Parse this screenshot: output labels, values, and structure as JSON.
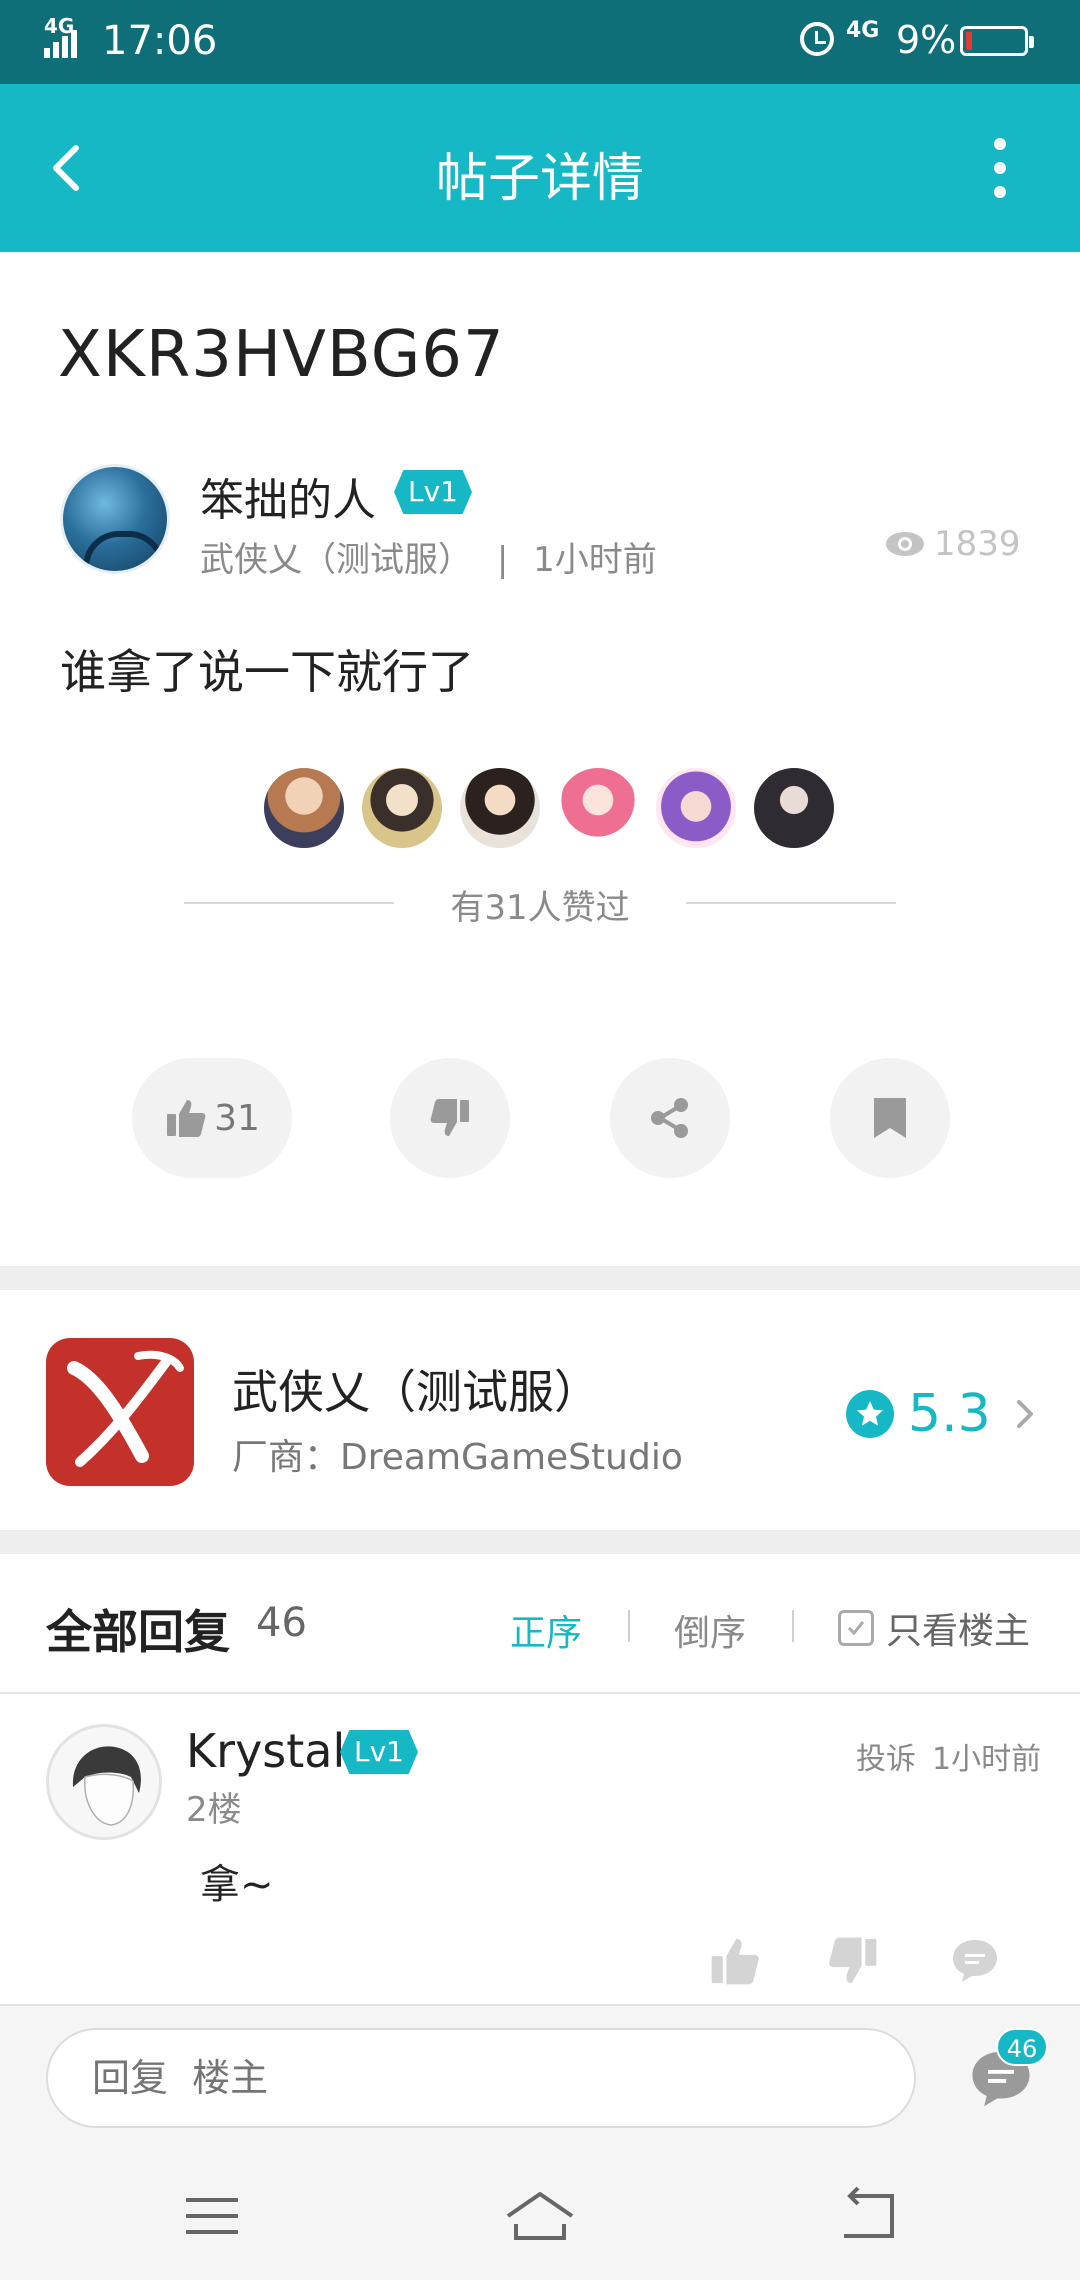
{
  "status_bar": {
    "network": "4G",
    "time": "17:06",
    "network2": "4G",
    "battery": "9%"
  },
  "header": {
    "title": "帖子详情"
  },
  "post": {
    "title": "XKR3HVBG67",
    "author": "笨拙的人",
    "level": "Lv1",
    "game": "武侠乂（测试服）",
    "separator": "|",
    "time": "1小时前",
    "views": "1839",
    "content": "谁拿了说一下就行了",
    "likers_text": "有31人赞过",
    "like_count": "31"
  },
  "game_card": {
    "name": "武侠乂（测试服）",
    "developer": "厂商：DreamGameStudio",
    "rating": "5.3"
  },
  "replies": {
    "title": "全部回复",
    "count": "46",
    "sort_asc": "正序",
    "sort_desc": "倒序",
    "only_op": "只看楼主",
    "items": [
      {
        "author": "Krystal",
        "level": "Lv1",
        "floor": "2楼",
        "report": "投诉",
        "time": "1小时前",
        "content": "拿~"
      }
    ]
  },
  "bottom": {
    "reply_placeholder": "回复  楼主",
    "comment_badge": "46"
  },
  "colors": {
    "accent": "#17b8c6",
    "statusbar": "#0f6f78"
  }
}
